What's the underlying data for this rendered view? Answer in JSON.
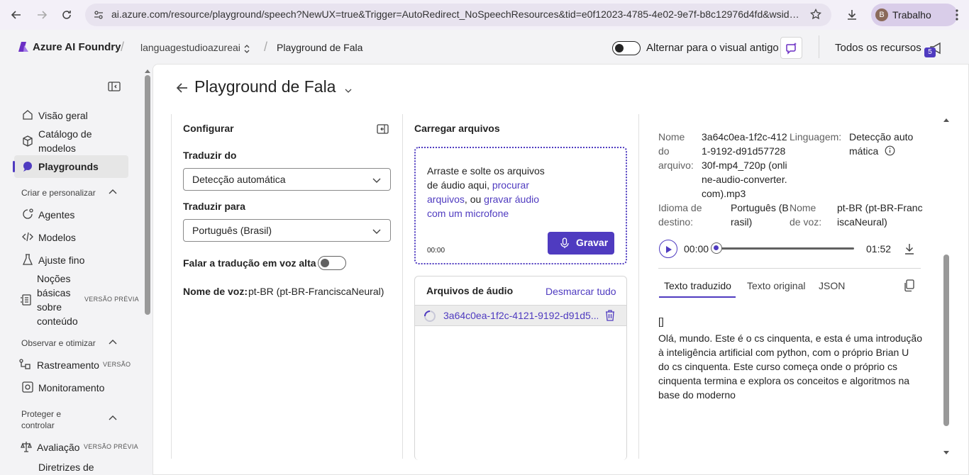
{
  "browser": {
    "url": "ai.azure.com/resource/playground/speech?NewUX=true&Trigger=AutoRedirect_NoSpeechResources&tid=e0f12023-4785-4e02-9e7f-b8c12976d4fd&wsid=...",
    "profile_initial": "B",
    "profile_name": "Trabalho"
  },
  "header": {
    "brand": "Azure AI Foundry",
    "resource": "languagestudioazureai",
    "page": "Playground de Fala",
    "toggle_label": "Alternar para o visual antigo",
    "all_resources": "Todos os recursos",
    "notification_count": "5"
  },
  "sidebar": {
    "items": [
      {
        "label": "Visão geral"
      },
      {
        "label": "Catálogo de",
        "label2": "modelos"
      },
      {
        "label": "Playgrounds"
      }
    ],
    "section_build": "Criar e personalizar",
    "build_items": [
      {
        "label": "Agentes"
      },
      {
        "label": "Modelos"
      },
      {
        "label": "Ajuste fino"
      },
      {
        "label_lines": [
          "Noções",
          "básicas",
          "sobre",
          "conteúdo"
        ],
        "badge": "VERSÃO PRÉVIA"
      }
    ],
    "section_observe": "Observar e otimizar",
    "observe_items": [
      {
        "label": "Rastreamento",
        "badge": "VERSÃO"
      },
      {
        "label": "Monitoramento"
      }
    ],
    "section_protect_1": "Proteger e",
    "section_protect_2": "controlar",
    "protect_items": [
      {
        "label": "Avaliação",
        "badge": "VERSÃO PRÉVIA"
      },
      {
        "label": "Diretrizes de"
      }
    ]
  },
  "main": {
    "title": "Playground de Fala",
    "configure": {
      "title": "Configurar",
      "from_label": "Traduzir do",
      "from_value": "Detecção automática",
      "to_label": "Traduzir para",
      "to_value": "Português (Brasil)",
      "speak_label": "Falar a tradução em voz alta",
      "voice_label": "Nome de voz:",
      "voice_value": "pt-BR (pt-BR-FranciscaNeural)"
    },
    "upload": {
      "title": "Carregar arquivos",
      "drop_text": "Arraste e solte os arquivos de áudio aqui,",
      "browse_link": "procurar arquivos",
      "or_text": ", ou",
      "record_link": "gravar áudio com um microfone",
      "timer": "00:00",
      "record_button": "Gravar",
      "files_title": "Arquivos de áudio",
      "unselect_all": "Desmarcar tudo",
      "file_name": "3a64c0ea-1f2c-4121-9192-d91d5..."
    },
    "result": {
      "file_key_1": "Nome",
      "file_key_2": "do",
      "file_key_3": "arquivo:",
      "file_lines": [
        "3a64c0ea-1f2c-412",
        "1-9192-d91d57728",
        "30f-mp4_720p (onli",
        "ne-audio-converter.",
        "com).mp3"
      ],
      "lang_key": "Linguagem:",
      "lang_lines": [
        "Detecção auto",
        "mática"
      ],
      "target_key_1": "Idioma de",
      "target_key_2": "destino:",
      "target_lines": [
        "Português (B",
        "rasil)"
      ],
      "voice_key_1": "Nome",
      "voice_key_2": "de voz:",
      "voice_lines": [
        "pt-BR (pt-BR-Franc",
        "iscaNeural)"
      ],
      "time_current": "00:00",
      "time_total": "01:52",
      "progress": 0,
      "tabs": [
        "Texto traduzido",
        "Texto original",
        "JSON"
      ],
      "bracket": "[]",
      "translated_text": "Olá, mundo. Este é o cs cinquenta, e esta é uma introdução à inteligência artificial com python, com o próprio Brian U do cs cinquenta. Este curso começa onde o próprio cs cinquenta termina e explora os conceitos e algoritmos na base do moderno"
    }
  },
  "colors": {
    "accent": "#4f3bc0",
    "brand": "#6b2fc4"
  }
}
